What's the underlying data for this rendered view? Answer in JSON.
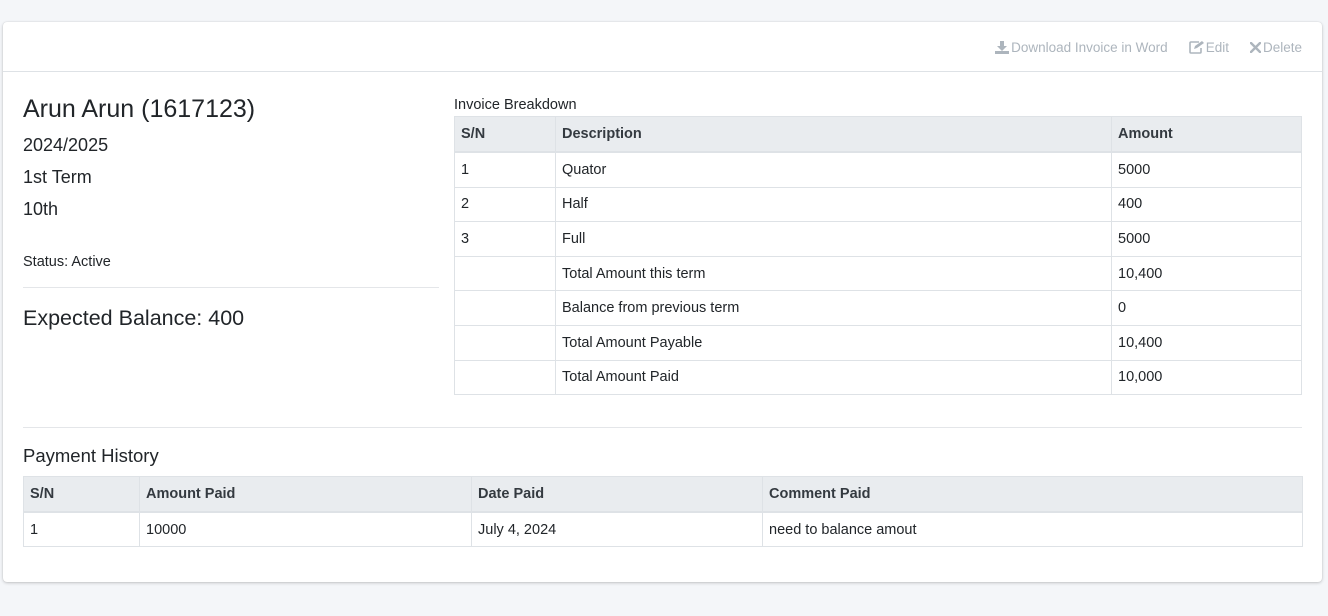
{
  "toolbar": {
    "download_label": "Download Invoice in Word",
    "edit_label": "Edit",
    "delete_label": "Delete"
  },
  "student": {
    "name": "Arun Arun (1617123)",
    "session": "2024/2025",
    "term": "1st Term",
    "class": "10th",
    "status": "Status: Active",
    "expected_balance": "Expected Balance: 400"
  },
  "invoice": {
    "title": "Invoice Breakdown",
    "headers": [
      "S/N",
      "Description",
      "Amount"
    ],
    "rows": [
      [
        "1",
        "Quator",
        "5000"
      ],
      [
        "2",
        "Half",
        "400"
      ],
      [
        "3",
        "Full",
        "5000"
      ],
      [
        "",
        "Total Amount this term",
        "10,400"
      ],
      [
        "",
        "Balance from previous term",
        "0"
      ],
      [
        "",
        "Total Amount Payable",
        "10,400"
      ],
      [
        "",
        "Total Amount Paid",
        "10,000"
      ]
    ]
  },
  "payment_history": {
    "title": "Payment History",
    "headers": [
      "S/N",
      "Amount Paid",
      "Date Paid",
      "Comment Paid"
    ],
    "rows": [
      [
        "1",
        "10000",
        "July 4, 2024",
        "need to balance amout"
      ]
    ]
  },
  "icons": {
    "download": "download-icon",
    "edit": "edit-icon",
    "delete": "close-icon"
  },
  "colors": {
    "tool_text": "#adb5bd",
    "table_header_bg": "#e9ecef",
    "page_bg": "#f4f6f9"
  }
}
